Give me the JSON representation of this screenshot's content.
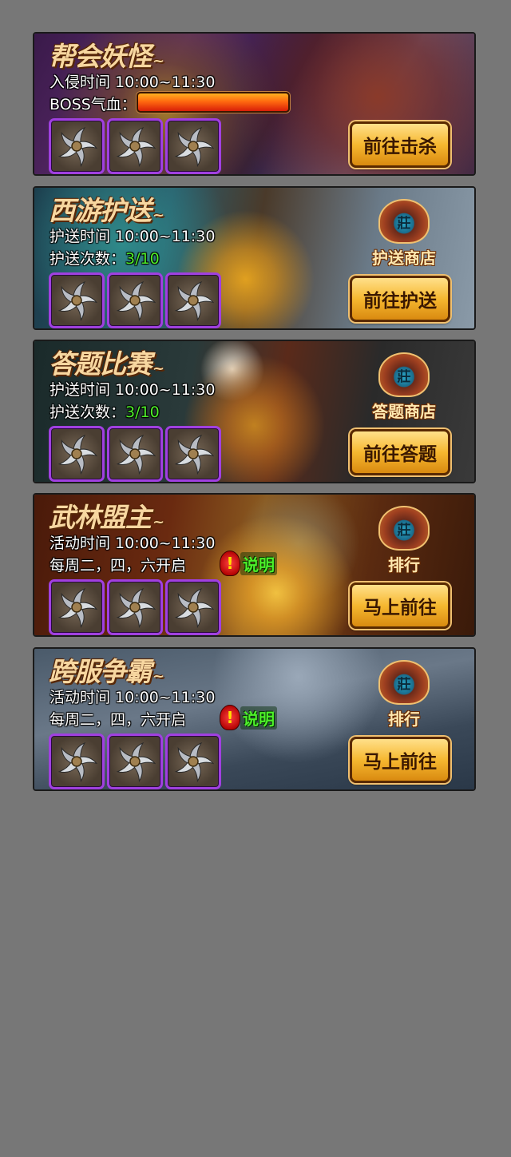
{
  "panels": [
    {
      "title": "帮会妖怪",
      "line1": "入侵时间 10:00~11:30",
      "line2_label": "BOSS气血：",
      "boss_hp_fraction": 1.0,
      "button": "前往击杀"
    },
    {
      "title": "西游护送",
      "line1": "护送时间 10:00~11:30",
      "line2_label": "护送次数：",
      "line2_value": "3/10",
      "shop_icon_text": "莊",
      "shop_label": "护送商店",
      "button": "前往护送"
    },
    {
      "title": "答题比赛",
      "line1": "护送时间 10:00~11:30",
      "line2_label": "护送次数：",
      "line2_value": "3/10",
      "shop_icon_text": "莊",
      "shop_label": "答题商店",
      "button": "前往答题"
    },
    {
      "title": "武林盟主",
      "line1": "活动时间 10:00~11:30",
      "line2_label": "每周二，四，六开启",
      "note_mark": "!",
      "note_label": "说明",
      "shop_icon_text": "莊",
      "shop_label": "排行",
      "button": "马上前往"
    },
    {
      "title": "跨服争霸",
      "line1": "活动时间 10:00~11:30",
      "line2_label": "每周二，四，六开启",
      "note_mark": "!",
      "note_label": "说明",
      "shop_icon_text": "莊",
      "shop_label": "排行",
      "button": "马上前往"
    }
  ],
  "reward_icon": "shuriken-icon",
  "colors": {
    "slot_border": "#a040e0",
    "highlight_green": "#4ef02a",
    "button_gold": "#f6b830"
  }
}
